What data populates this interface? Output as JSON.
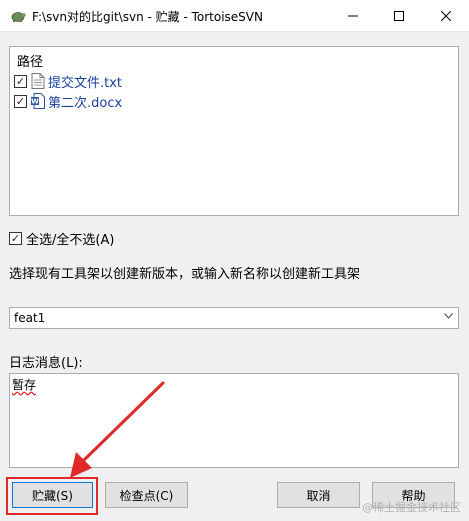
{
  "window": {
    "title": "F:\\svn对的比git\\svn - 贮藏 - TortoiseSVN",
    "minimize": "—",
    "maximize": "☐",
    "close": "✕"
  },
  "file_list": {
    "header": "路径",
    "items": [
      {
        "name": "提交文件.txt",
        "checked": true,
        "icon": "text-file-icon"
      },
      {
        "name": "第二次.docx",
        "checked": true,
        "icon": "word-doc-icon"
      }
    ]
  },
  "select_all": {
    "label": "全选/全不选(A)",
    "checked": true
  },
  "instruction": "选择现有工具架以创建新版本，或输入新名称以创建新工具架",
  "shelf_combo": {
    "value": "feat1"
  },
  "log": {
    "label": "日志消息(L):",
    "value": "暂存"
  },
  "buttons": {
    "stash": "贮藏(S)",
    "checkpoint": "检查点(C)",
    "cancel": "取消",
    "help": "帮助"
  },
  "annotation": {
    "color": "#e02a2a"
  },
  "watermark": "@稀土掘金技术社区"
}
